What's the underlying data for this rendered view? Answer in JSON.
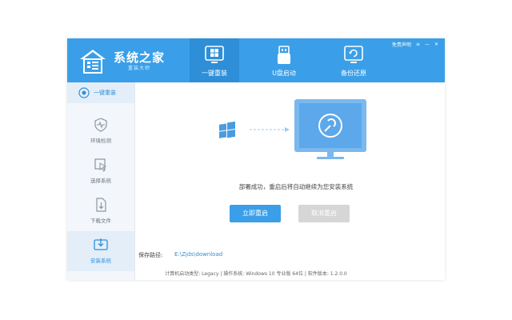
{
  "app": {
    "brand": "系统之家",
    "brand_sub": "重装大师"
  },
  "top_right": {
    "disclaimer": "免责声明",
    "menu": "≡",
    "minimize": "—",
    "close": "✕"
  },
  "tabs": [
    {
      "label": "一键重装",
      "icon": "windows-icon",
      "active": true
    },
    {
      "label": "U盘启动",
      "icon": "usb-icon",
      "active": false
    },
    {
      "label": "备份还原",
      "icon": "backup-icon",
      "active": false
    }
  ],
  "sidebar": {
    "top": {
      "label": "一键重装",
      "icon": "target-icon"
    },
    "items": [
      {
        "label": "环境检测",
        "icon": "shield-pulse-icon",
        "active": false
      },
      {
        "label": "选择系统",
        "icon": "cursor-select-icon",
        "active": false
      },
      {
        "label": "下载文件",
        "icon": "download-file-icon",
        "active": false
      },
      {
        "label": "安装系统",
        "icon": "install-tray-icon",
        "active": true
      }
    ]
  },
  "main": {
    "message": "部署成功，重启后将自动继续为您安装系统",
    "restart_button": "立即重启",
    "cancel_button": "取消重启",
    "save_path_label": "保存路径:",
    "save_path_value": "E:\\Zjds\\download"
  },
  "footer": {
    "text": "计算机启动类型:  Legacy  |  操作系统:  Windows 10 专业版 64位  |  软件版本:  1.2.0.0"
  },
  "colors": {
    "accent": "#3a9fe8",
    "accent_dark": "#2e8fd8",
    "disabled": "#d6d6d6",
    "sidebar_bg": "#f3f6fa"
  }
}
